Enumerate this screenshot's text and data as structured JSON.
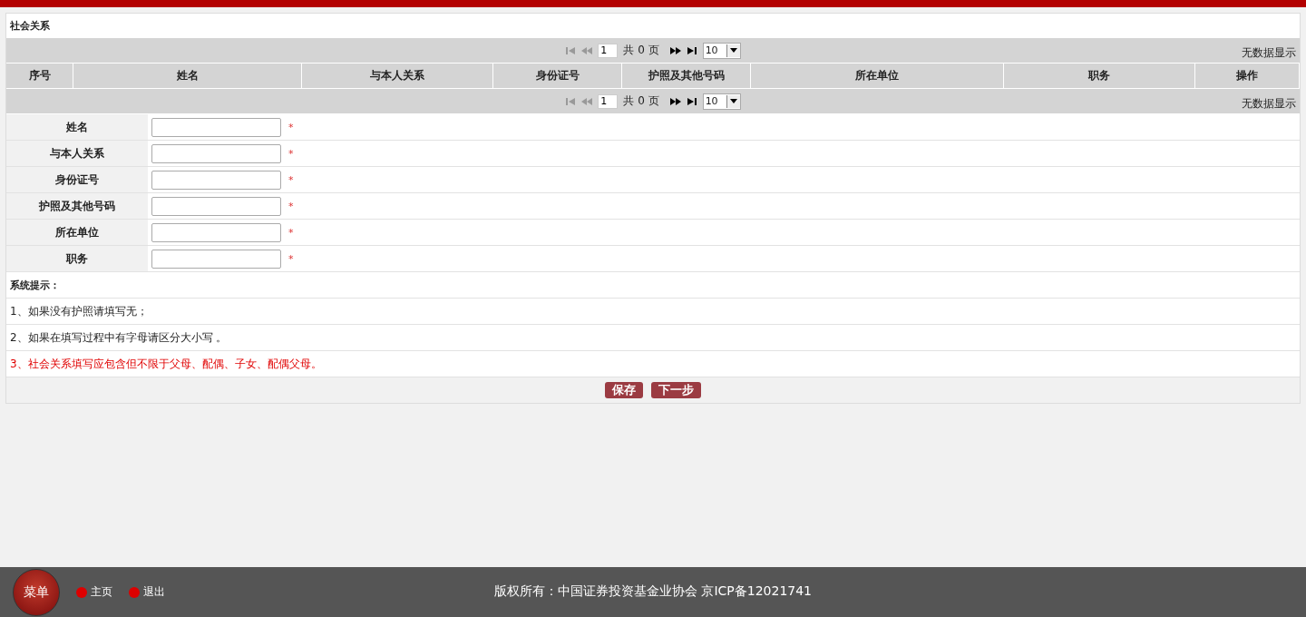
{
  "section": {
    "title": "社会关系"
  },
  "pagers": [
    {
      "nav_buttons": [
        {
          "kind": "first",
          "disabled": true
        },
        {
          "kind": "prev",
          "disabled": true
        },
        {
          "kind": "next",
          "disabled": false
        },
        {
          "kind": "last",
          "disabled": false
        }
      ],
      "page": "1",
      "total_text": "共 0 页",
      "page_size": "10",
      "empty_text": "无数据显示"
    },
    {
      "nav_buttons": [
        {
          "kind": "first",
          "disabled": true
        },
        {
          "kind": "prev",
          "disabled": true
        },
        {
          "kind": "next",
          "disabled": false
        },
        {
          "kind": "last",
          "disabled": false
        }
      ],
      "page": "1",
      "total_text": "共 0 页",
      "page_size": "10",
      "empty_text": "无数据显示"
    }
  ],
  "table": {
    "columns": [
      "序号",
      "姓名",
      "与本人关系",
      "身份证号",
      "护照及其他号码",
      "所在单位",
      "职务",
      "操作"
    ]
  },
  "form": {
    "fields": [
      {
        "label": "姓名",
        "required_mark": "*"
      },
      {
        "label": "与本人关系",
        "required_mark": "*"
      },
      {
        "label": "身份证号",
        "required_mark": "*"
      },
      {
        "label": "护照及其他号码",
        "required_mark": "*"
      },
      {
        "label": "所在单位",
        "required_mark": "*"
      },
      {
        "label": "职务",
        "required_mark": "*"
      }
    ]
  },
  "tips": {
    "title": "系统提示：",
    "items": [
      {
        "text": "1、如果没有护照请填写无；",
        "kind": "normal"
      },
      {
        "text": "2、如果在填写过程中有字母请区分大小写 。",
        "kind": "normal"
      },
      {
        "text": "3、社会关系填写应包含但不限于父母、配偶、子女、配偶父母。",
        "kind": "warning"
      }
    ]
  },
  "buttons": [
    "保存",
    "下一步"
  ],
  "footer": {
    "nav": [
      {
        "label": "菜单",
        "kind": "round"
      },
      {
        "label": "主页",
        "kind": "dot"
      },
      {
        "label": "退出",
        "kind": "dot"
      }
    ],
    "copyright": "版权所有：中国证券投资基金业协会 京ICP备12021741"
  }
}
